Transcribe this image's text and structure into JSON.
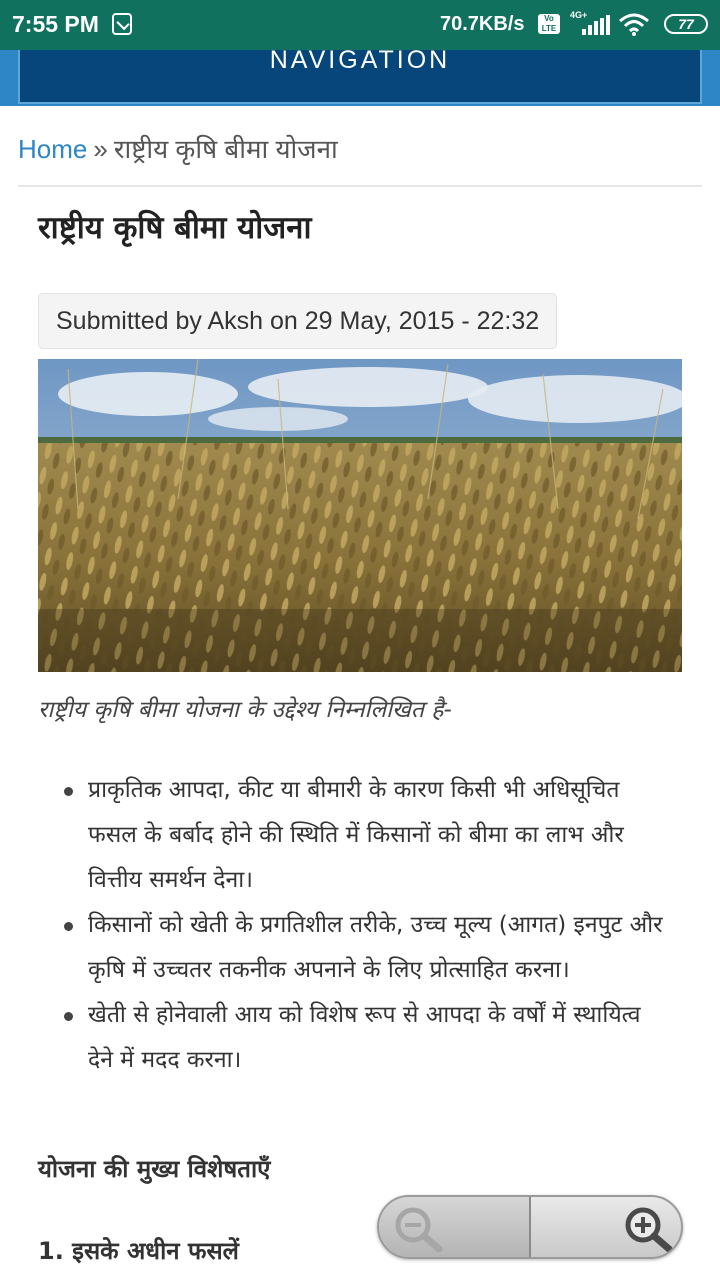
{
  "status_bar": {
    "time": "7:55 PM",
    "speed": "70.7KB/s",
    "volte": "Vo LTE",
    "network": "4G+",
    "battery": "77"
  },
  "nav": {
    "label": "NAVIGATION"
  },
  "breadcrumb": {
    "home": "Home",
    "separator": "»",
    "current": "राष्ट्रीय कृषि बीमा योजना"
  },
  "article": {
    "title": "राष्ट्रीय कृषि बीमा योजना",
    "submitted": "Submitted by Aksh on 29 May, 2015 - 22:32",
    "caption": "राष्ट्रीय कृषि बीमा योजना के उद्देश्य निम्नलिखित है-",
    "objectives": [
      "प्राकृतिक आपदा, कीट या बीमारी के कारण किसी भी अधिसूचित फसल के बर्बाद होने की स्थिति में किसानों को बीमा का लाभ और वित्तीय समर्थन देना।",
      "किसानों को खेती के प्रगतिशील तरीके, उच्च मूल्य (आगत) इनपुट और कृषि में उच्चतर तकनीक अपनाने के लिए प्रोत्साहित करना।",
      "खेती से होनेवाली आय को विशेष रूप से आपदा के वर्षों में स्थायित्व देने में मदद करना।"
    ],
    "section_heading": "योजना की मुख्य विशेषताएँ",
    "sub_heading": "1. इसके अधीन फसलें"
  },
  "icons": {
    "zoom_out": "zoom-out-icon",
    "zoom_in": "zoom-in-icon"
  },
  "colors": {
    "status_bar": "#11715f",
    "nav_bar": "#07467a",
    "link": "#2e86c7"
  }
}
